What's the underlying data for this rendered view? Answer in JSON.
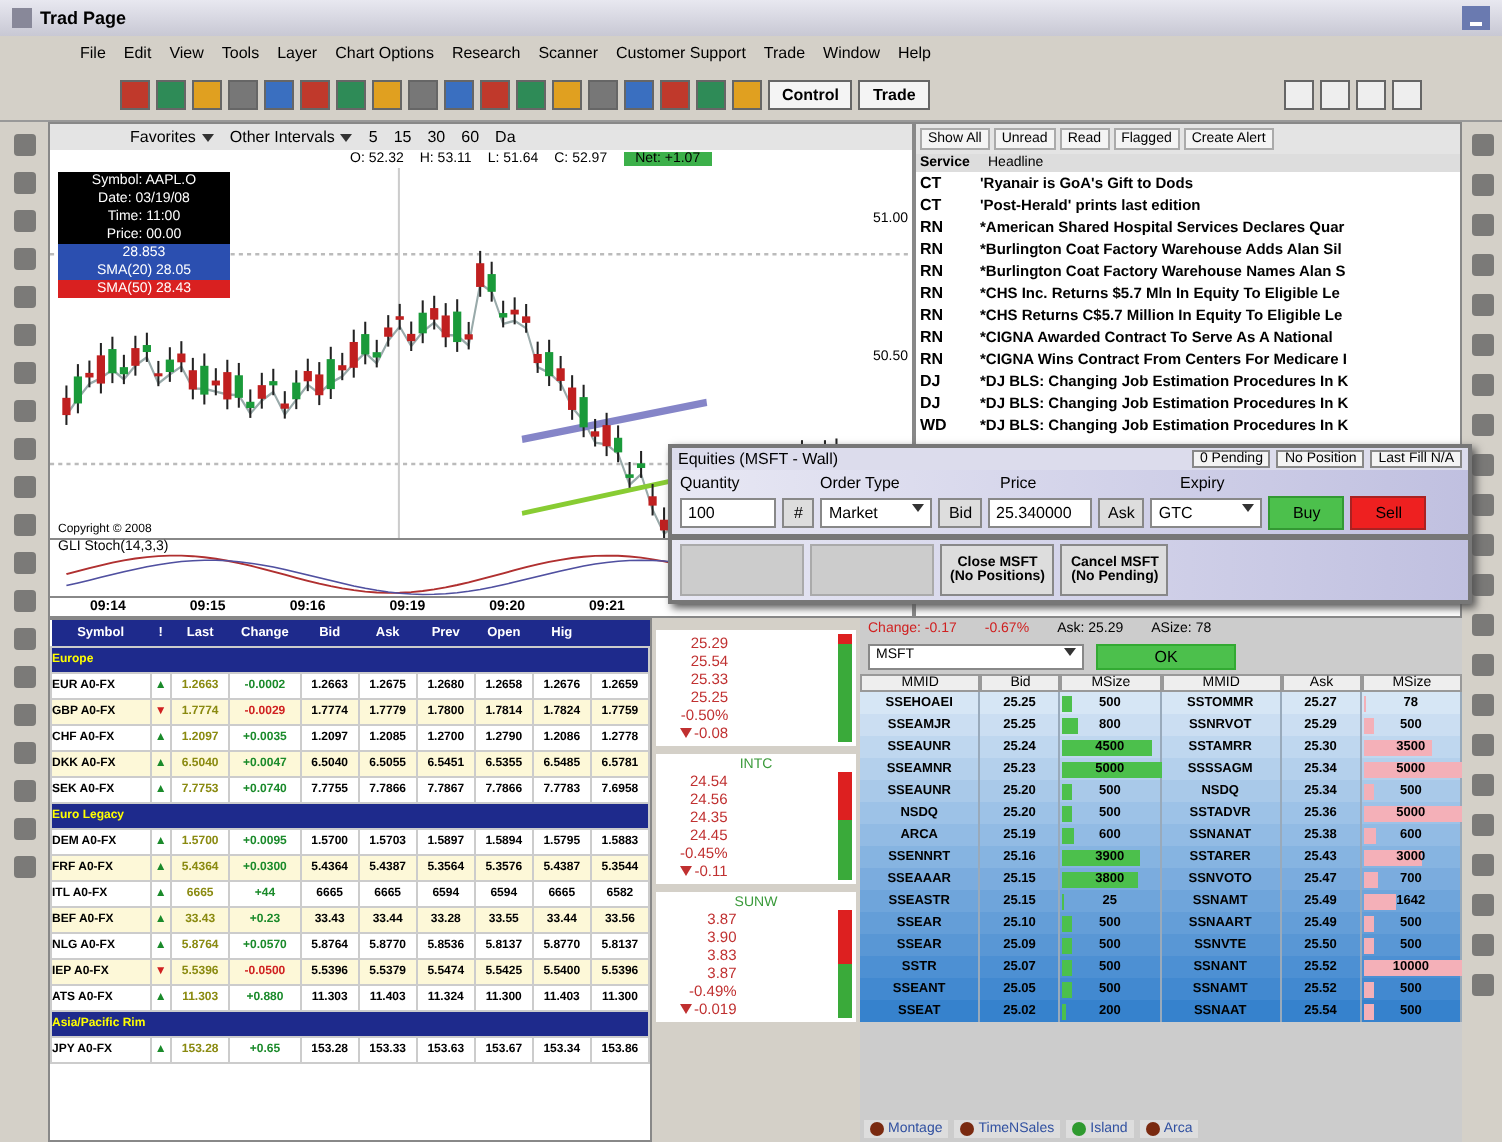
{
  "window": {
    "title": "Trad Page"
  },
  "menu": [
    "File",
    "Edit",
    "View",
    "Tools",
    "Layer",
    "Chart Options",
    "Research",
    "Scanner",
    "Customer Support",
    "Trade",
    "Window",
    "Help"
  ],
  "toolbar": {
    "buttons": [
      "Control",
      "Trade"
    ]
  },
  "chart": {
    "favorites": "Favorites",
    "other": "Other Intervals",
    "periods": [
      "5",
      "15",
      "30",
      "60",
      "Da"
    ],
    "ohlc": [
      "O: 52.32",
      "H: 53.11",
      "L: 51.64",
      "C: 52.97"
    ],
    "net": "Net: +1.07",
    "info": [
      {
        "text": "Symbol: AAPL.O",
        "color": "#000000"
      },
      {
        "text": "Date: 03/19/08",
        "color": "#000000"
      },
      {
        "text": "Time: 11:00",
        "color": "#000000"
      },
      {
        "text": "Price: 00.00",
        "color": "#000000"
      },
      {
        "text": "28.853",
        "color": "#2b4fb0"
      },
      {
        "text": "SMA(20) 28.05",
        "color": "#2b4fb0"
      },
      {
        "text": "SMA(50) 28.43",
        "color": "#d92020"
      }
    ],
    "price_labels": [
      "51.00",
      "50.50"
    ],
    "copyright": "Copyright © 2008",
    "indicator": "GLI Stoch(14,3,3)",
    "times": [
      "09:14",
      "09:15",
      "09:16",
      "09:19",
      "09:20",
      "09:21"
    ]
  },
  "news": {
    "filters": [
      "Show All",
      "Unread",
      "Read",
      "Flagged",
      "Create Alert"
    ],
    "columns": [
      "Service",
      "Headline"
    ],
    "items": [
      {
        "service": "CT",
        "headline": "'Ryanair is GoA's Gift to Dods"
      },
      {
        "service": "CT",
        "headline": "'Post-Herald' prints last edition"
      },
      {
        "service": "RN",
        "headline": "*American Shared Hospital Services Declares Quar"
      },
      {
        "service": "RN",
        "headline": "*Burlington Coat Factory Warehouse Adds Alan Sil"
      },
      {
        "service": "RN",
        "headline": "*Burlington Coat Factory Warehouse Names Alan S"
      },
      {
        "service": "RN",
        "headline": "*CHS Inc. Returns $5.7 Mln In Equity To Eligible Le"
      },
      {
        "service": "RN",
        "headline": "*CHS Returns C$5.7 Million In Equity To Eligible Le"
      },
      {
        "service": "RN",
        "headline": "*CIGNA Awarded Contract To Serve As A National"
      },
      {
        "service": "RN",
        "headline": "*CIGNA Wins Contract From Centers For Medicare I"
      },
      {
        "service": "DJ",
        "headline": "*DJ BLS: Changing Job Estimation Procedures In K"
      },
      {
        "service": "DJ",
        "headline": "*DJ BLS: Changing Job Estimation Procedures In K"
      },
      {
        "service": "WD",
        "headline": "*DJ BLS: Changing Job Estimation Procedures In K"
      }
    ]
  },
  "order": {
    "title": "Equities (MSFT - Wall)",
    "status": [
      "0 Pending",
      "No Position",
      "Last Fill N/A"
    ],
    "quantity_label": "Quantity",
    "quantity": "100",
    "pound": "#",
    "type_label": "Order Type",
    "type": "Market",
    "price_label": "Price",
    "price": "25.340000",
    "expiry_label": "Expiry",
    "expiry": "GTC",
    "bid": "Bid",
    "ask": "Ask",
    "buy": "Buy",
    "sell": "Sell",
    "close": [
      "Close MSFT",
      "(No Positions)"
    ],
    "cancel": [
      "Cancel MSFT",
      "(No Pending)"
    ]
  },
  "quotes": {
    "columns": [
      "Symbol",
      "!",
      "Last",
      "Change",
      "Bid",
      "Ask",
      "Prev",
      "Open",
      "Hig"
    ],
    "groups": [
      {
        "name": "Europe",
        "rows": [
          {
            "up": true,
            "cells": [
              "EUR A0-FX",
              "▲",
              "1.2663",
              "-0.0002",
              "1.2663",
              "1.2675",
              "1.2680",
              "1.2658",
              "1.2676",
              "1.2659"
            ]
          },
          {
            "up": false,
            "cells": [
              "GBP A0-FX",
              "▼",
              "1.7774",
              "-0.0029",
              "1.7774",
              "1.7779",
              "1.7800",
              "1.7814",
              "1.7824",
              "1.7759"
            ]
          },
          {
            "up": true,
            "cells": [
              "CHF A0-FX",
              "▲",
              "1.2097",
              "+0.0035",
              "1.2097",
              "1.2085",
              "1.2700",
              "1.2790",
              "1.2086",
              "1.2778"
            ]
          },
          {
            "up": true,
            "cells": [
              "DKK A0-FX",
              "▲",
              "6.5040",
              "+0.0047",
              "6.5040",
              "6.5055",
              "6.5451",
              "6.5355",
              "6.5485",
              "6.5781"
            ]
          },
          {
            "up": true,
            "cells": [
              "SEK A0-FX",
              "▲",
              "7.7753",
              "+0.0740",
              "7.7755",
              "7.7866",
              "7.7867",
              "7.7866",
              "7.7783",
              "7.6958"
            ]
          }
        ]
      },
      {
        "name": "Euro Legacy",
        "rows": [
          {
            "up": true,
            "cells": [
              "DEM A0-FX",
              "▲",
              "1.5700",
              "+0.0095",
              "1.5700",
              "1.5703",
              "1.5897",
              "1.5894",
              "1.5795",
              "1.5883"
            ]
          },
          {
            "up": true,
            "cells": [
              "FRF A0-FX",
              "▲",
              "5.4364",
              "+0.0300",
              "5.4364",
              "5.4387",
              "5.3564",
              "5.3576",
              "5.4387",
              "5.3544"
            ]
          },
          {
            "up": true,
            "cells": [
              "ITL A0-FX",
              "▲",
              "6665",
              "+44",
              "6665",
              "6665",
              "6594",
              "6594",
              "6665",
              "6582"
            ]
          },
          {
            "up": true,
            "cells": [
              "BEF A0-FX",
              "▲",
              "33.43",
              "+0.23",
              "33.43",
              "33.44",
              "33.28",
              "33.55",
              "33.44",
              "33.56"
            ]
          },
          {
            "up": true,
            "cells": [
              "NLG A0-FX",
              "▲",
              "5.8764",
              "+0.0570",
              "5.8764",
              "5.8770",
              "5.8536",
              "5.8137",
              "5.8770",
              "5.8137"
            ]
          },
          {
            "up": false,
            "cells": [
              "IEP A0-FX",
              "▼",
              "5.5396",
              "-0.0500",
              "5.5396",
              "5.5379",
              "5.5474",
              "5.5425",
              "5.5400",
              "5.5396"
            ]
          },
          {
            "up": true,
            "cells": [
              "ATS A0-FX",
              "▲",
              "11.303",
              "+0.880",
              "11.303",
              "11.403",
              "11.324",
              "11.300",
              "11.403",
              "11.300"
            ]
          }
        ]
      },
      {
        "name": "Asia/Pacific Rim",
        "rows": [
          {
            "up": true,
            "cells": [
              "JPY A0-FX",
              "▲",
              "153.28",
              "+0.65",
              "153.28",
              "153.33",
              "153.63",
              "153.67",
              "153.34",
              "153.86"
            ]
          }
        ]
      }
    ]
  },
  "tickers": [
    {
      "level": 0.1,
      "prices": [
        "25.29",
        "25.54",
        "25.33",
        "25.25"
      ],
      "percent": "-0.50%",
      "change": "-0.08"
    },
    {
      "name": "INTC",
      "level": 0.45,
      "prices": [
        "24.54",
        "24.56",
        "24.35",
        "24.45"
      ],
      "percent": "-0.45%",
      "change": "-0.11"
    },
    {
      "name": "SUNW",
      "level": 0.5,
      "prices": [
        "3.87",
        "3.90",
        "3.83",
        "3.87"
      ],
      "percent": "-0.49%",
      "change": "-0.019"
    }
  ],
  "level2": {
    "summary": [
      "Change: -0.17",
      "-0.67%",
      "Ask: 25.29",
      "ASize: 78"
    ],
    "symbol": "MSFT",
    "ok": "OK",
    "columns": [
      "MMID",
      "Bid",
      "MSize",
      "MMID",
      "Ask",
      "MSize"
    ],
    "rows": [
      [
        "SSEHOAEI",
        "25.25",
        "500",
        "SSTOMMR",
        "25.27",
        "78"
      ],
      [
        "SSEAMJR",
        "25.25",
        "800",
        "SSNRVOT",
        "25.29",
        "500"
      ],
      [
        "SSEAUNR",
        "25.24",
        "4500",
        "SSTAMRR",
        "25.30",
        "3500"
      ],
      [
        "SSEAMNR",
        "25.23",
        "5000",
        "SSSSAGM",
        "25.34",
        "5000"
      ],
      [
        "SSEAUNR",
        "25.20",
        "500",
        "NSDQ",
        "25.34",
        "500"
      ],
      [
        "NSDQ",
        "25.20",
        "500",
        "SSTADVR",
        "25.36",
        "5000"
      ],
      [
        "ARCA",
        "25.19",
        "600",
        "SSNANAT",
        "25.38",
        "600"
      ],
      [
        "SSENNRT",
        "25.16",
        "3900",
        "SSTARER",
        "25.43",
        "3000"
      ],
      [
        "SSEAAAR",
        "25.15",
        "3800",
        "SSNVOTO",
        "25.47",
        "700"
      ],
      [
        "SSEASTR",
        "25.15",
        "25",
        "SSNAMT",
        "25.49",
        "1642"
      ],
      [
        "SSEAR",
        "25.10",
        "500",
        "SSNAART",
        "25.49",
        "500"
      ],
      [
        "SSEAR",
        "25.09",
        "500",
        "SSNVTE",
        "25.50",
        "500"
      ],
      [
        "SSTR",
        "25.07",
        "500",
        "SSNANT",
        "25.52",
        "10000"
      ],
      [
        "SSEANT",
        "25.05",
        "500",
        "SSNAMT",
        "25.52",
        "500"
      ],
      [
        "SSEAT",
        "25.02",
        "200",
        "SSNAAT",
        "25.54",
        "500"
      ]
    ],
    "tabs": [
      {
        "label": "Montage",
        "color": "#7a2a10"
      },
      {
        "label": "TimeNSales",
        "color": "#7a2a10"
      },
      {
        "label": "Island",
        "color": "#2f9a2f"
      },
      {
        "label": "Arca",
        "color": "#7a2a10"
      }
    ]
  }
}
